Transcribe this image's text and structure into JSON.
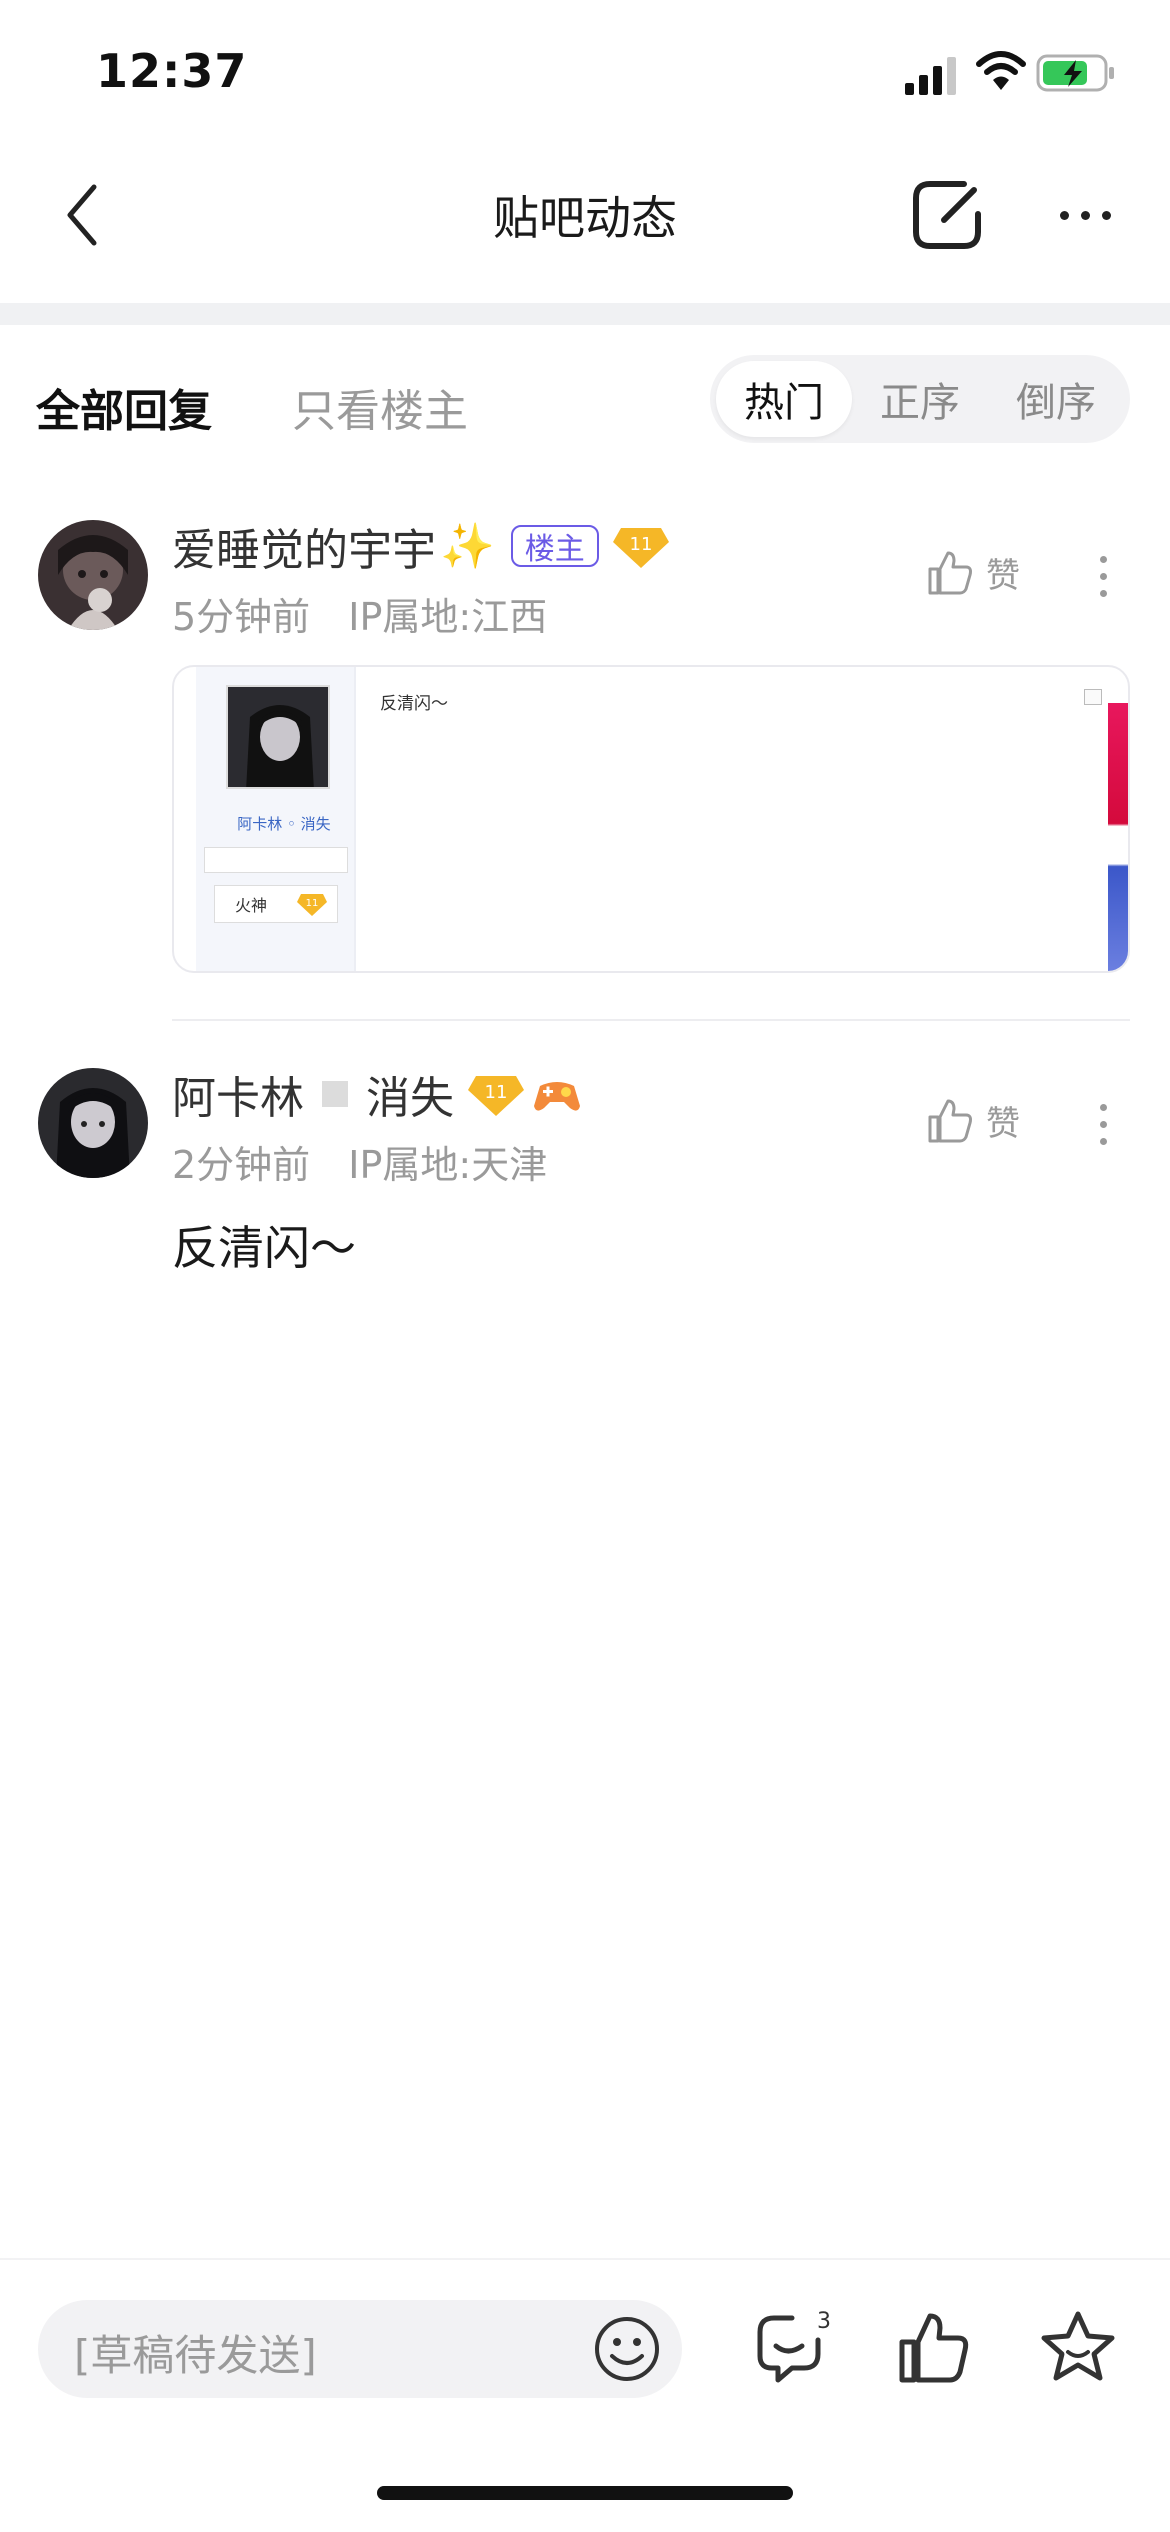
{
  "status_bar": {
    "time": "12:37"
  },
  "nav": {
    "title": "贴吧动态"
  },
  "filter": {
    "tab_all": "全部回复",
    "tab_owner": "只看楼主",
    "sort_options": [
      "热门",
      "正序",
      "倒序"
    ],
    "active_sort": "热门"
  },
  "posts": [
    {
      "username": "爱睡觉的宇宇",
      "sparkle": "✨",
      "owner_tag": "楼主",
      "level": "11",
      "time": "5分钟前",
      "ip": "IP属地:江西",
      "like_label": "赞",
      "embed": {
        "name": "阿卡林 ◦ 消失",
        "badge_label": "火神",
        "badge_level": "11",
        "text": "反清闪～"
      }
    },
    {
      "username_part1": "阿卡林",
      "username_part2": "消失",
      "level": "11",
      "time": "2分钟前",
      "ip": "IP属地:天津",
      "like_label": "赞",
      "content": "反清闪～"
    }
  ],
  "bottom_bar": {
    "draft_placeholder": "[草稿待发送]",
    "comment_count": "3"
  },
  "colors": {
    "accent_purple": "#6b5be6",
    "level_badge": "#f5b727",
    "muted_text": "#9a9a9a"
  },
  "icons": [
    "back-icon",
    "share-icon",
    "more-icon",
    "thumb-up-icon",
    "emoji-icon",
    "comment-icon",
    "star-icon",
    "level-badge-icon",
    "game-icon"
  ]
}
